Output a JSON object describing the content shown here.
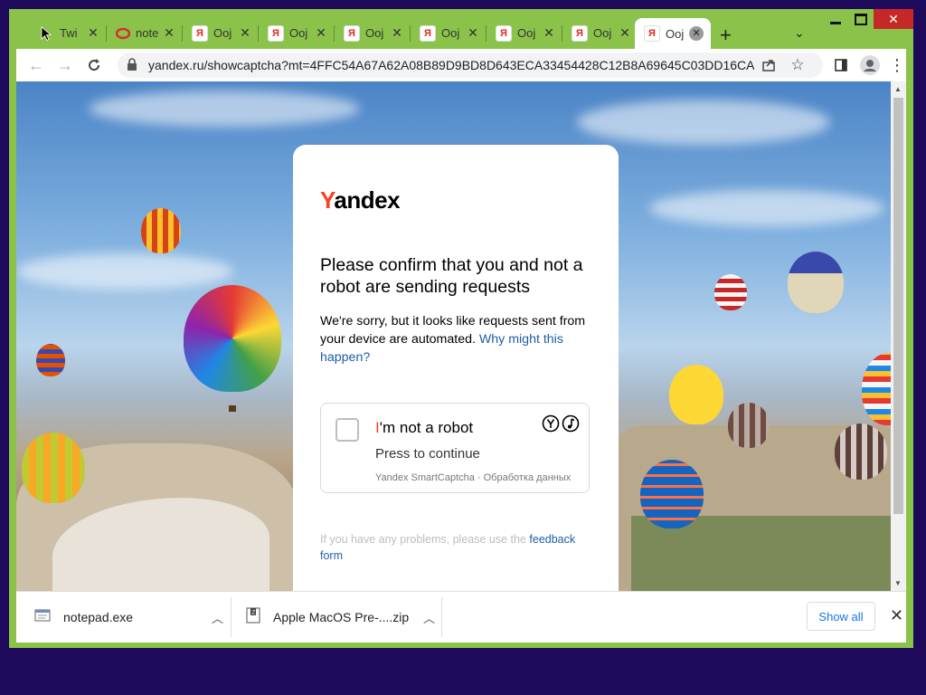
{
  "tabs": [
    {
      "title": "Twi",
      "icon": "cursor-arrow-icon"
    },
    {
      "title": "note",
      "icon": "tab-red-icon"
    },
    {
      "title": "Ooj",
      "icon": "yandex-icon"
    },
    {
      "title": "Ooj",
      "icon": "yandex-icon"
    },
    {
      "title": "Ooj",
      "icon": "yandex-icon"
    },
    {
      "title": "Ooj",
      "icon": "yandex-icon"
    },
    {
      "title": "Ooj",
      "icon": "yandex-icon"
    },
    {
      "title": "Ooj",
      "icon": "yandex-icon"
    },
    {
      "title": "Ooj",
      "icon": "yandex-icon",
      "active": true
    }
  ],
  "yandex_glyph": "Я",
  "address_bar": {
    "url": "yandex.ru/showcaptcha?mt=4FFC54A67A62A08B89D9BD8D643ECA33454428C12B8A69645C03DD16CA9C..."
  },
  "captcha": {
    "logo_first": "Y",
    "logo_rest": "andex",
    "heading": "Please confirm that you and not a robot are sending requests",
    "description": "We're sorry, but it looks like requests sent from your device are automated.",
    "why_link": "Why might this happen?",
    "checkbox_label_first": "I",
    "checkbox_label_rest": "'m not a robot",
    "checkbox_sub": "Press to continue",
    "checkbox_footer": "Yandex SmartCaptcha · Обработка данных",
    "problems_text": "If you have any problems, please use the",
    "feedback_link": "feedback form"
  },
  "downloads": {
    "items": [
      {
        "name": "notepad.exe"
      },
      {
        "name": "Apple MacOS Pre-....zip"
      }
    ],
    "show_all": "Show all"
  },
  "colors": {
    "frame": "#8bc34a",
    "desktop": "#1e0a5a",
    "yandex_red": "#fc3f1d",
    "link": "#1d5ea8"
  }
}
